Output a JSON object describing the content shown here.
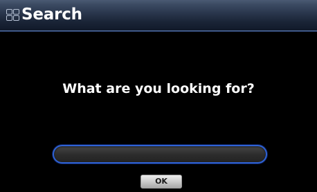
{
  "window": {
    "title": "Search",
    "icon": "grid-icon",
    "accent_color": "#2f63d6"
  },
  "dialog": {
    "prompt": "What are you looking for?",
    "search_field": {
      "value": "",
      "placeholder": ""
    },
    "ok_label": "OK"
  }
}
